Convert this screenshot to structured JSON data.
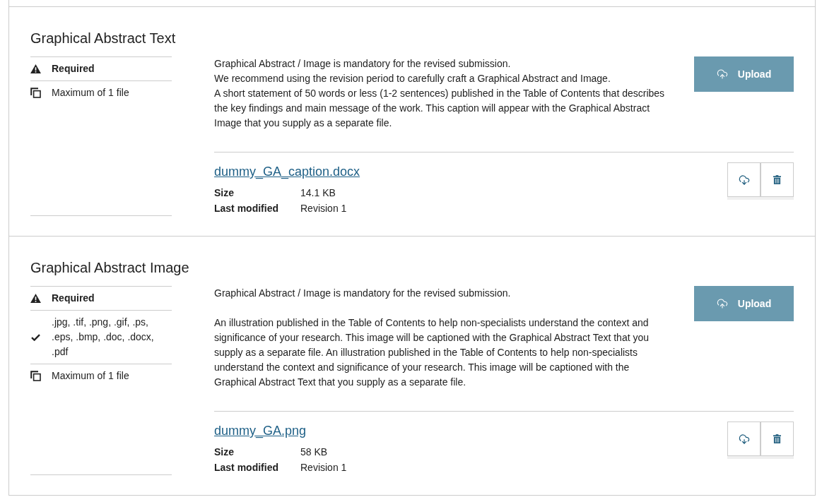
{
  "sections": [
    {
      "title": "Graphical Abstract Text",
      "requirements": [
        {
          "kind": "required",
          "text": "Required"
        },
        {
          "kind": "max_files",
          "text": "Maximum of 1 file"
        }
      ],
      "description": "Graphical Abstract / Image is mandatory for the revised submission.\nWe recommend using the revision period to carefully craft a Graphical Abstract and Image.\nA short statement of 50 words or less (1-2 sentences) published in the Table of Contents that describes the key findings and main message of the work. This caption will appear with the Graphical Abstract Image that you supply as a separate file.",
      "upload_button": "Upload",
      "files": [
        {
          "name": "dummy_GA_caption.docx",
          "details": [
            {
              "label": "Size",
              "value": "14.1 KB"
            },
            {
              "label": "Last modified",
              "value": "Revision 1"
            }
          ]
        }
      ]
    },
    {
      "title": "Graphical Abstract Image",
      "requirements": [
        {
          "kind": "required",
          "text": "Required"
        },
        {
          "kind": "formats",
          "text": ".jpg, .tif, .png, .gif, .ps, .eps, .bmp, .doc, .docx, .pdf"
        },
        {
          "kind": "max_files",
          "text": "Maximum of 1 file"
        }
      ],
      "description": "Graphical Abstract / Image is mandatory for the revised submission.\n\nAn illustration published in the Table of Contents to help non-specialists understand the context and significance of your research. This image will be captioned with the Graphical Abstract Text that you supply as a separate file. An illustration published in the Table of Contents to help non-specialists understand the context and significance of your research. This image will be captioned with the Graphical Abstract Text that you supply as a separate file.",
      "upload_button": "Upload",
      "files": [
        {
          "name": "dummy_GA.png",
          "details": [
            {
              "label": "Size",
              "value": "58 KB"
            },
            {
              "label": "Last modified",
              "value": "Revision 1"
            }
          ]
        }
      ]
    }
  ]
}
